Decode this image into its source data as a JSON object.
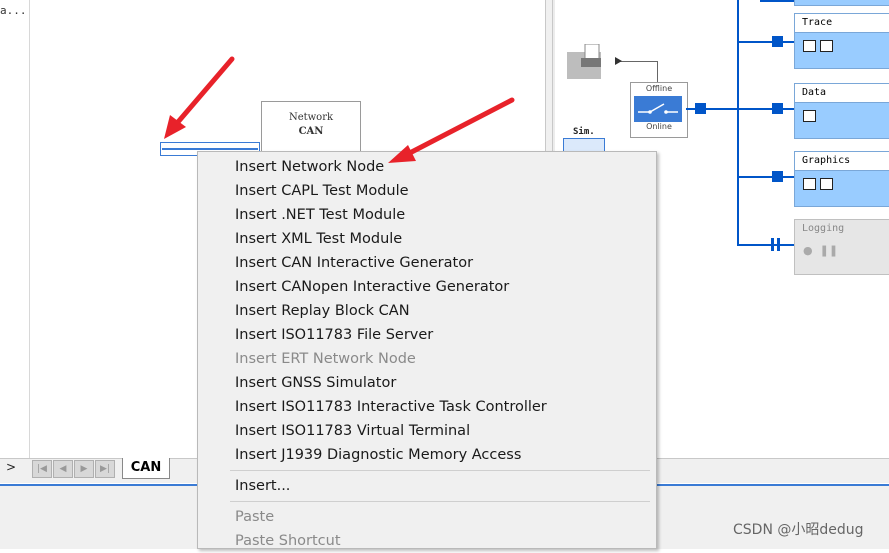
{
  "left_panel": {
    "text": "a..."
  },
  "tabs": {
    "active_tab": "CAN",
    "nav_arrow": ">"
  },
  "network_node": {
    "line1": "Network",
    "line2": "CAN",
    "line3": ""
  },
  "simulation": {
    "offline_label": "Offline",
    "online_label": "Online",
    "sim_label": "Sim."
  },
  "analysis_windows": [
    {
      "title": "Trace"
    },
    {
      "title": "Data"
    },
    {
      "title": "Graphics"
    },
    {
      "title": "Logging"
    }
  ],
  "context_menu": {
    "items": [
      {
        "label": "Insert Network Node",
        "enabled": true
      },
      {
        "label": "Insert CAPL Test Module",
        "enabled": true
      },
      {
        "label": "Insert .NET Test Module",
        "enabled": true
      },
      {
        "label": "Insert XML Test Module",
        "enabled": true
      },
      {
        "label": "Insert CAN Interactive Generator",
        "enabled": true
      },
      {
        "label": "Insert CANopen Interactive Generator",
        "enabled": true
      },
      {
        "label": "Insert Replay Block CAN",
        "enabled": true
      },
      {
        "label": "Insert ISO11783 File Server",
        "enabled": true
      },
      {
        "label": "Insert ERT Network Node",
        "enabled": false
      },
      {
        "label": "Insert GNSS Simulator",
        "enabled": true
      },
      {
        "label": "Insert ISO11783 Interactive Task Controller",
        "enabled": true
      },
      {
        "label": "Insert ISO11783 Virtual Terminal",
        "enabled": true
      },
      {
        "label": "Insert J1939 Diagnostic Memory Access",
        "enabled": true
      }
    ],
    "insert_more": "Insert...",
    "paste": "Paste",
    "paste_shortcut": "Paste Shortcut"
  },
  "watermark": "CSDN @小昭dedug",
  "colors": {
    "accent": "#0055c8",
    "window_bg": "#99ccff",
    "menu_bg": "#f0f0f0",
    "arrow": "#e8222a"
  }
}
